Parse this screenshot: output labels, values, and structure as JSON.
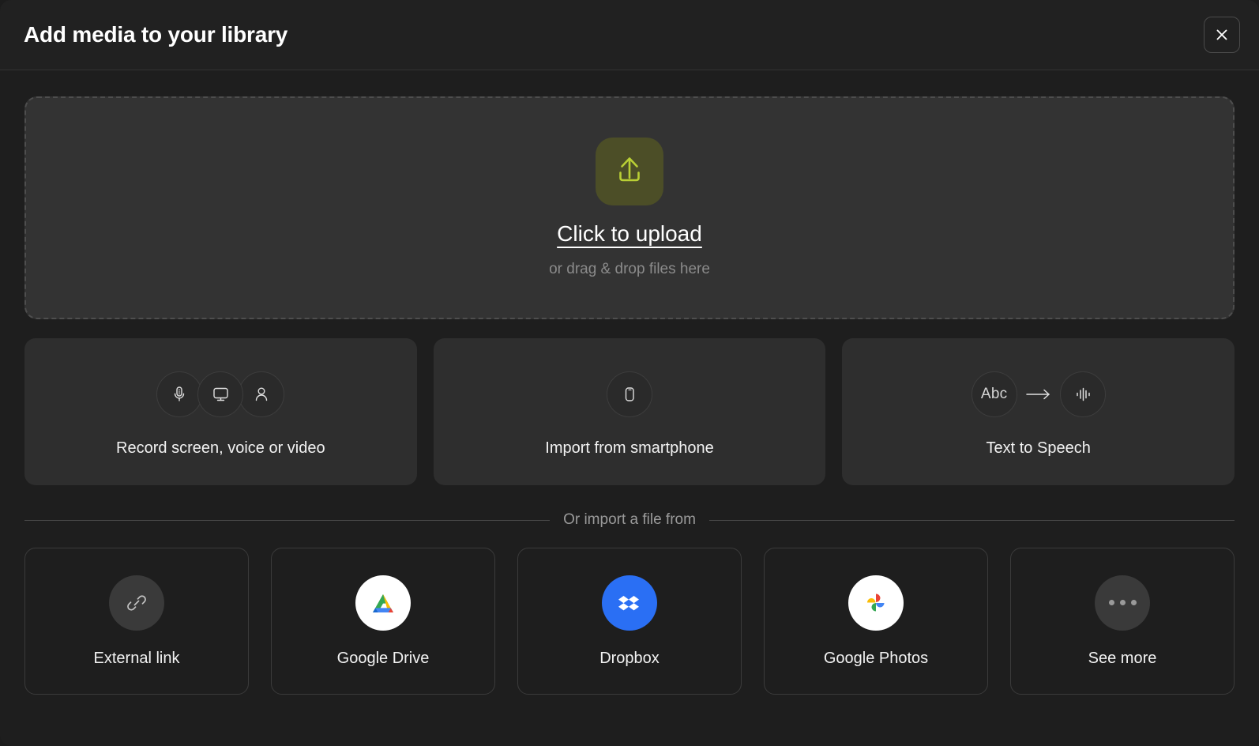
{
  "header": {
    "title": "Add media to your library",
    "close_icon": "close-icon",
    "close_label": "Close"
  },
  "dropzone": {
    "upload_icon": "upload-icon",
    "primary_text": "Click to upload",
    "secondary_text": "or drag & drop files here",
    "icon_bg_color": "#4c4e27",
    "icon_color": "#b9cf35"
  },
  "actions": [
    {
      "label": "Record screen, voice or video",
      "icons": [
        "microphone-icon",
        "monitor-icon",
        "person-icon"
      ]
    },
    {
      "label": "Import from smartphone",
      "icons": [
        "smartphone-icon"
      ]
    },
    {
      "label": "Text to Speech",
      "icons": [
        "abc-text-icon",
        "arrow-right-icon",
        "waveform-icon"
      ],
      "abc_text": "Abc"
    }
  ],
  "divider": {
    "text": "Or import a file from"
  },
  "sources": [
    {
      "label": "External link",
      "icon": "link-icon",
      "icon_style": "plain"
    },
    {
      "label": "Google Drive",
      "icon": "google-drive-icon",
      "icon_style": "white"
    },
    {
      "label": "Dropbox",
      "icon": "dropbox-icon",
      "icon_style": "blue"
    },
    {
      "label": "Google Photos",
      "icon": "google-photos-icon",
      "icon_style": "white"
    },
    {
      "label": "See more",
      "icon": "ellipsis-icon",
      "icon_style": "plain"
    }
  ],
  "colors": {
    "background": "#1e1e1e",
    "header_background": "#212121",
    "card_background": "#2e2e2e",
    "dropzone_background": "#333333",
    "accent_green": "#b9cf35",
    "dropbox_blue": "#2a6ff4",
    "google_blue": "#4285f4",
    "google_red": "#ea4335",
    "google_yellow": "#fbbc04",
    "google_green": "#34a853",
    "text_primary": "#ffffff",
    "text_muted": "#8b8b8b"
  }
}
